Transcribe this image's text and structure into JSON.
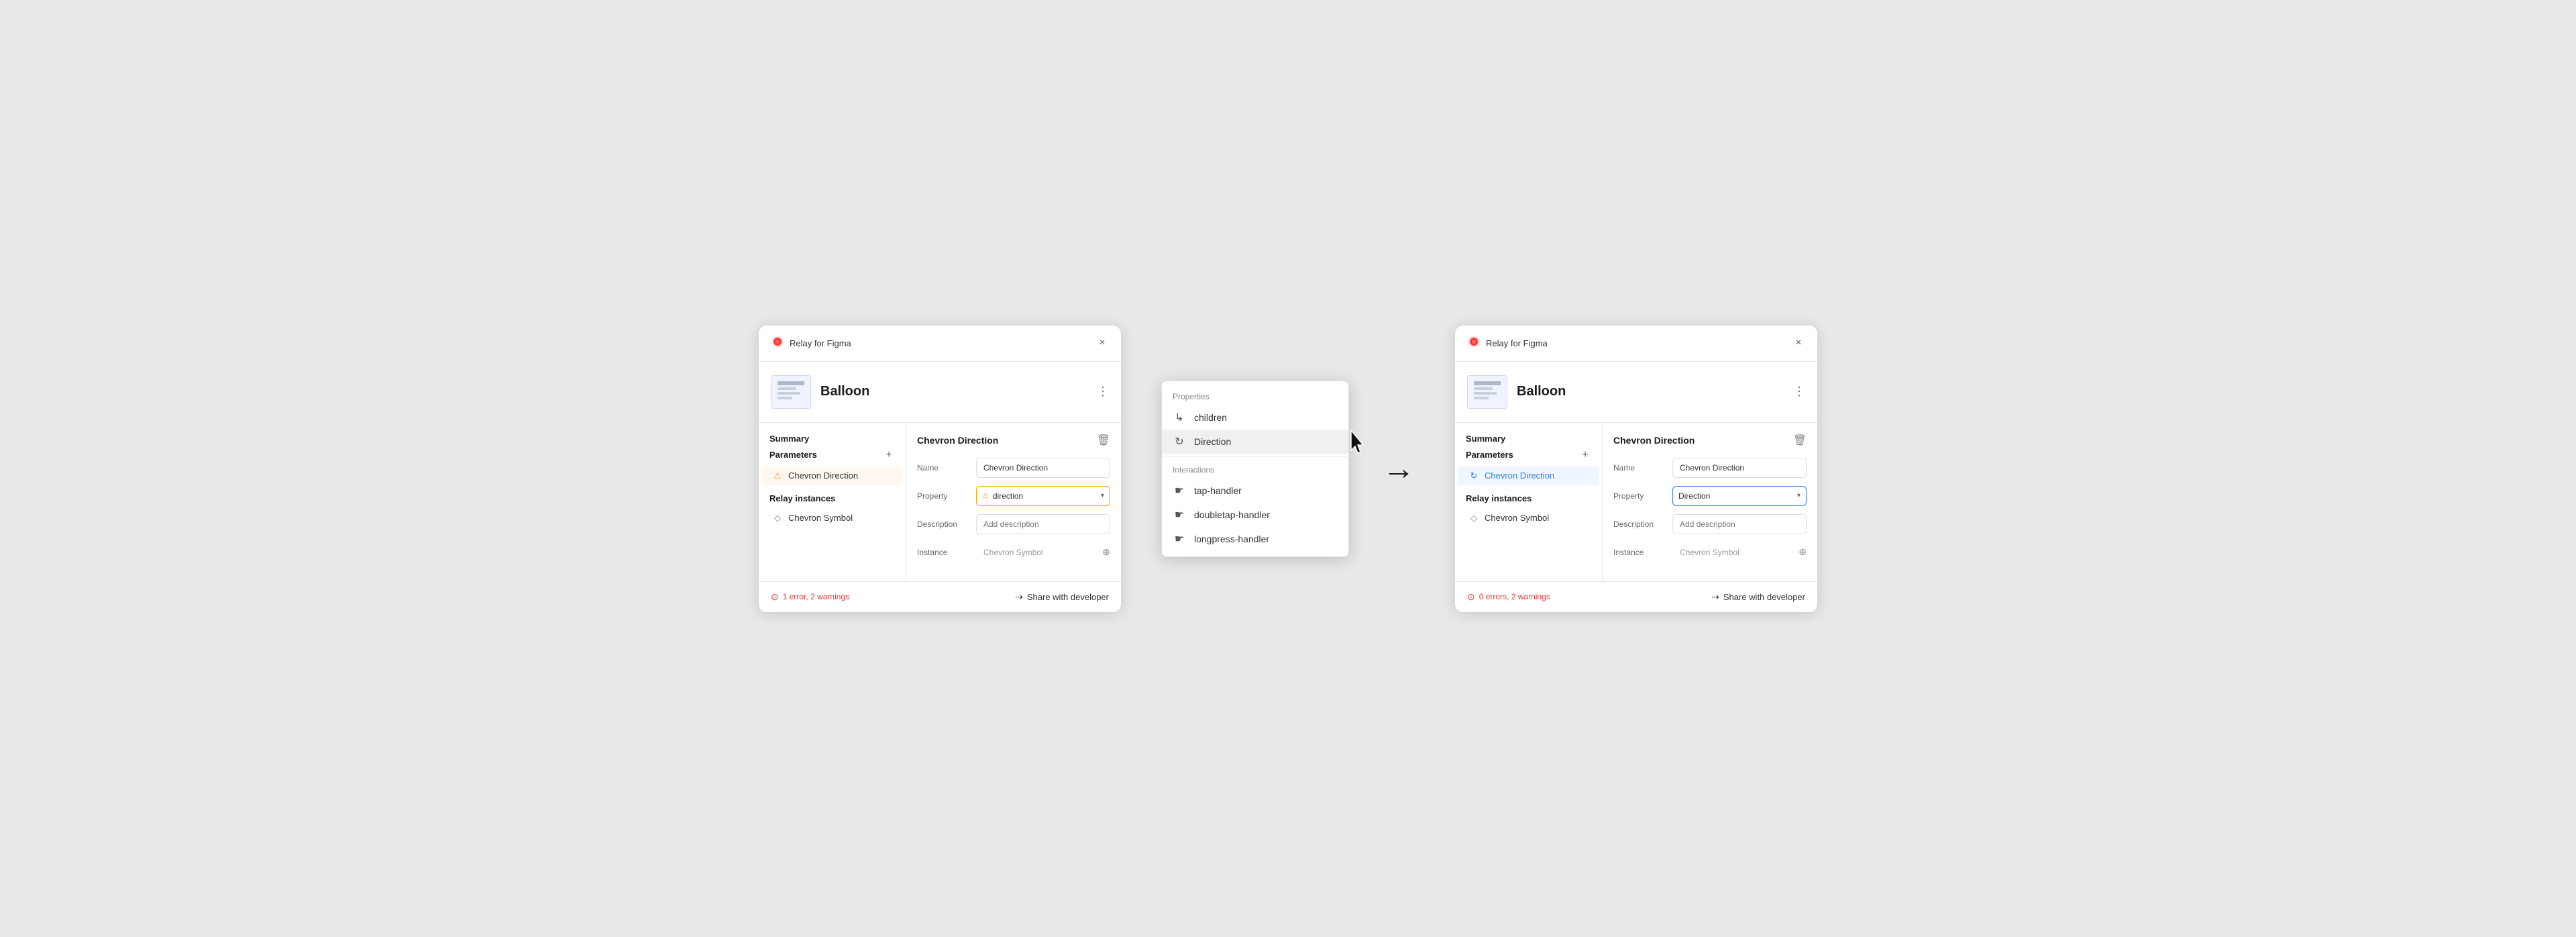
{
  "app": {
    "title": "Relay for Figma",
    "close_label": "×"
  },
  "component": {
    "name": "Balloon"
  },
  "left_panel": {
    "summary_title": "Summary",
    "parameters_title": "Parameters",
    "chevron_direction_label": "Chevron Direction",
    "relay_instances_title": "Relay instances",
    "chevron_symbol_label": "Chevron Symbol",
    "detail_title": "Chevron Direction",
    "name_label": "Name",
    "name_value": "Chevron Direction",
    "property_label": "Property",
    "property_value": "direction",
    "description_label": "Description",
    "description_placeholder": "Add description",
    "instance_label": "Instance",
    "instance_value": "Chevron Symbol",
    "error_text": "1 error, 2 warnings",
    "share_label": "Share with developer"
  },
  "right_panel": {
    "summary_title": "Summary",
    "parameters_title": "Parameters",
    "chevron_direction_label": "Chevron Direction",
    "relay_instances_title": "Relay instances",
    "chevron_symbol_label": "Chevron Symbol",
    "detail_title": "Chevron Direction",
    "name_label": "Name",
    "name_value": "Chevron Direction",
    "property_label": "Property",
    "property_value": "Direction",
    "description_label": "Description",
    "description_placeholder": "Add description",
    "instance_label": "Instance",
    "instance_value": "Chevron Symbol",
    "error_text": "0 errors, 2 warnings",
    "share_label": "Share with developer"
  },
  "popup": {
    "properties_title": "Properties",
    "children_label": "children",
    "direction_label": "Direction",
    "interactions_title": "Interactions",
    "tap_handler_label": "tap-handler",
    "doubletap_handler_label": "doubletap-handler",
    "longpress_handler_label": "longpress-handler"
  },
  "arrow": "→"
}
